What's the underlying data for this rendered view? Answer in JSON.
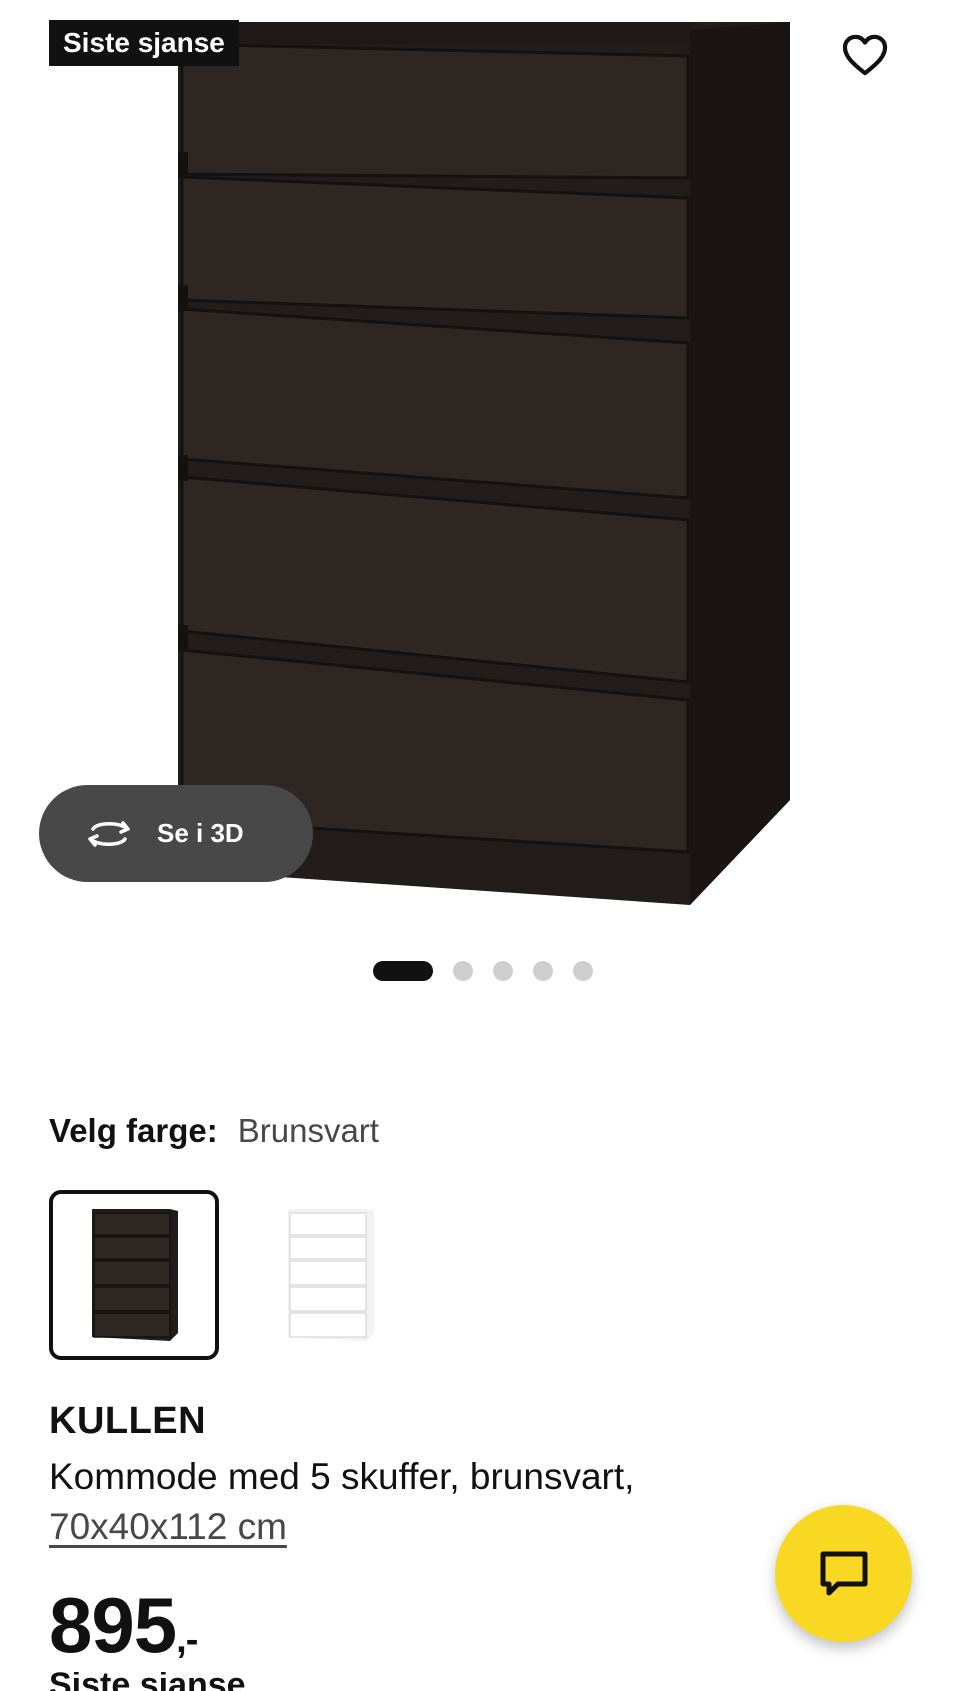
{
  "product": {
    "badge": "Siste sjanse",
    "view_3d_label": "Se i 3D",
    "gallery": {
      "count": 5,
      "active_index": 0
    },
    "color_label": "Velg farge:",
    "color_value": "Brunsvart",
    "swatches": [
      {
        "name": "Brunsvart",
        "color": "#2b2522",
        "selected": true
      },
      {
        "name": "Hvit",
        "color": "#ffffff",
        "selected": false
      }
    ],
    "name": "KULLEN",
    "description": "Kommode med 5 skuffer, brunsvart,",
    "dimensions": "70x40x112 cm",
    "price": "895",
    "price_suffix": ",-",
    "cut_off_text": "Siste sjanse"
  },
  "icons": {
    "favorite": "heart-icon",
    "rotate": "rotate-3d-icon",
    "chat": "chat-icon"
  },
  "colors": {
    "accent_yellow": "#f8d823",
    "dark": "#111111",
    "pill": "#484848"
  }
}
